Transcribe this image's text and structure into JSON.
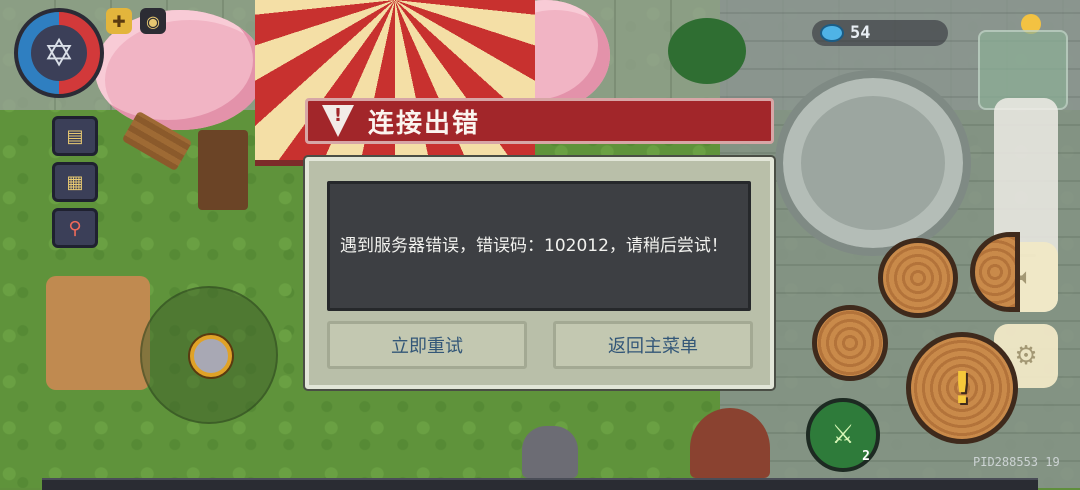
{
  "hud": {
    "gem_count": "54",
    "pid_label": "PID288553  19",
    "skill_charges": "2",
    "alert_symbol": "!"
  },
  "dialog": {
    "title": "连接出错",
    "message": "遇到服务器错误，错误码：102012，请稍后尝试！",
    "retry_button": "立即重试",
    "main_menu_button": "返回主菜单"
  },
  "colors": {
    "dialog_header": "#a2262a",
    "dialog_body": "#b9bfa9",
    "message_box": "#3d3f43",
    "button_text": "#335778"
  },
  "icons": [
    "star-of-david-icon",
    "shield-badge-icon",
    "mask-badge-icon",
    "book-icon",
    "map-icon",
    "magnifier-icon",
    "gem-icon",
    "speaker-icon",
    "gear-icon",
    "warning-icon",
    "alert-icon",
    "skill-icon"
  ]
}
